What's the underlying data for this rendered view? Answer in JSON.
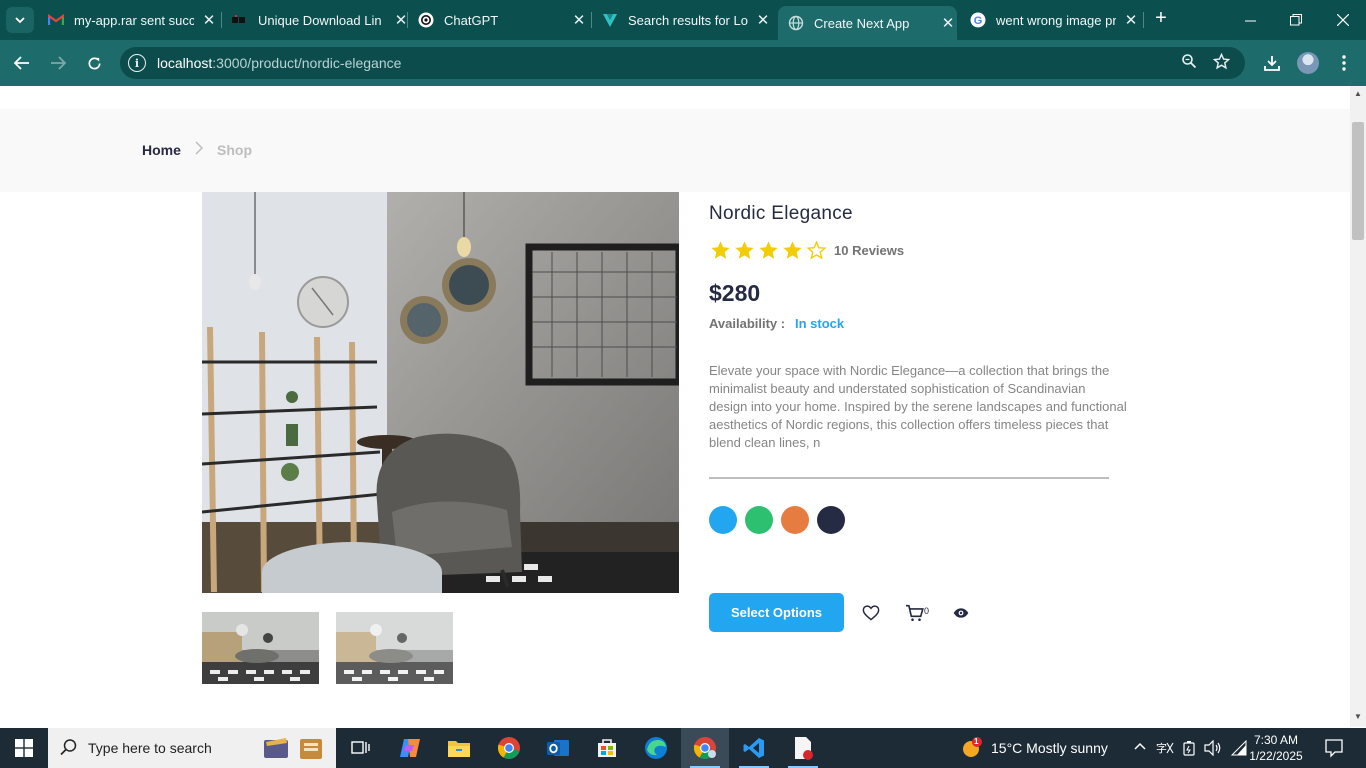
{
  "browser": {
    "tabs": [
      {
        "title": "my-app.rar sent succe",
        "icon": "gmail-icon"
      },
      {
        "title": "Unique Download Lin",
        "icon": "site-icon"
      },
      {
        "title": "ChatGPT",
        "icon": "chatgpt-icon"
      },
      {
        "title": "Search results for Log",
        "icon": "vuetify-icon"
      },
      {
        "title": "Create Next App",
        "icon": "globe-icon"
      },
      {
        "title": "went wrong image pr",
        "icon": "google-icon"
      }
    ],
    "active_tab": 4,
    "url_host": "localhost",
    "url_path": ":3000/product/nordic-elegance"
  },
  "breadcrumb": {
    "home": "Home",
    "shop": "Shop"
  },
  "product": {
    "title": "Nordic Elegance",
    "rating": 4,
    "rating_max": 5,
    "reviews": "10 Reviews",
    "price": "$280",
    "availability_label": "Availability :",
    "availability_value": "In stock",
    "description": "Elevate your space with Nordic Elegance—a collection that brings the minimalist beauty and understated sophistication of Scandinavian design into your home. Inspired by the serene landscapes and functional aesthetics of Nordic regions, this collection offers timeless pieces that blend clean lines, n",
    "colors": [
      "#23a6f0",
      "#2dc071",
      "#e77c40",
      "#252b42"
    ],
    "select_button": "Select Options",
    "cart_count": "0"
  },
  "colors": {
    "accent": "#23a6f0",
    "heading": "#252b42",
    "star": "#f3cd03"
  },
  "taskbar": {
    "search_placeholder": "Type here to search",
    "weather": "15°C  Mostly sunny",
    "weather_badge": "1",
    "time": "7:30 AM",
    "date": "1/22/2025"
  }
}
